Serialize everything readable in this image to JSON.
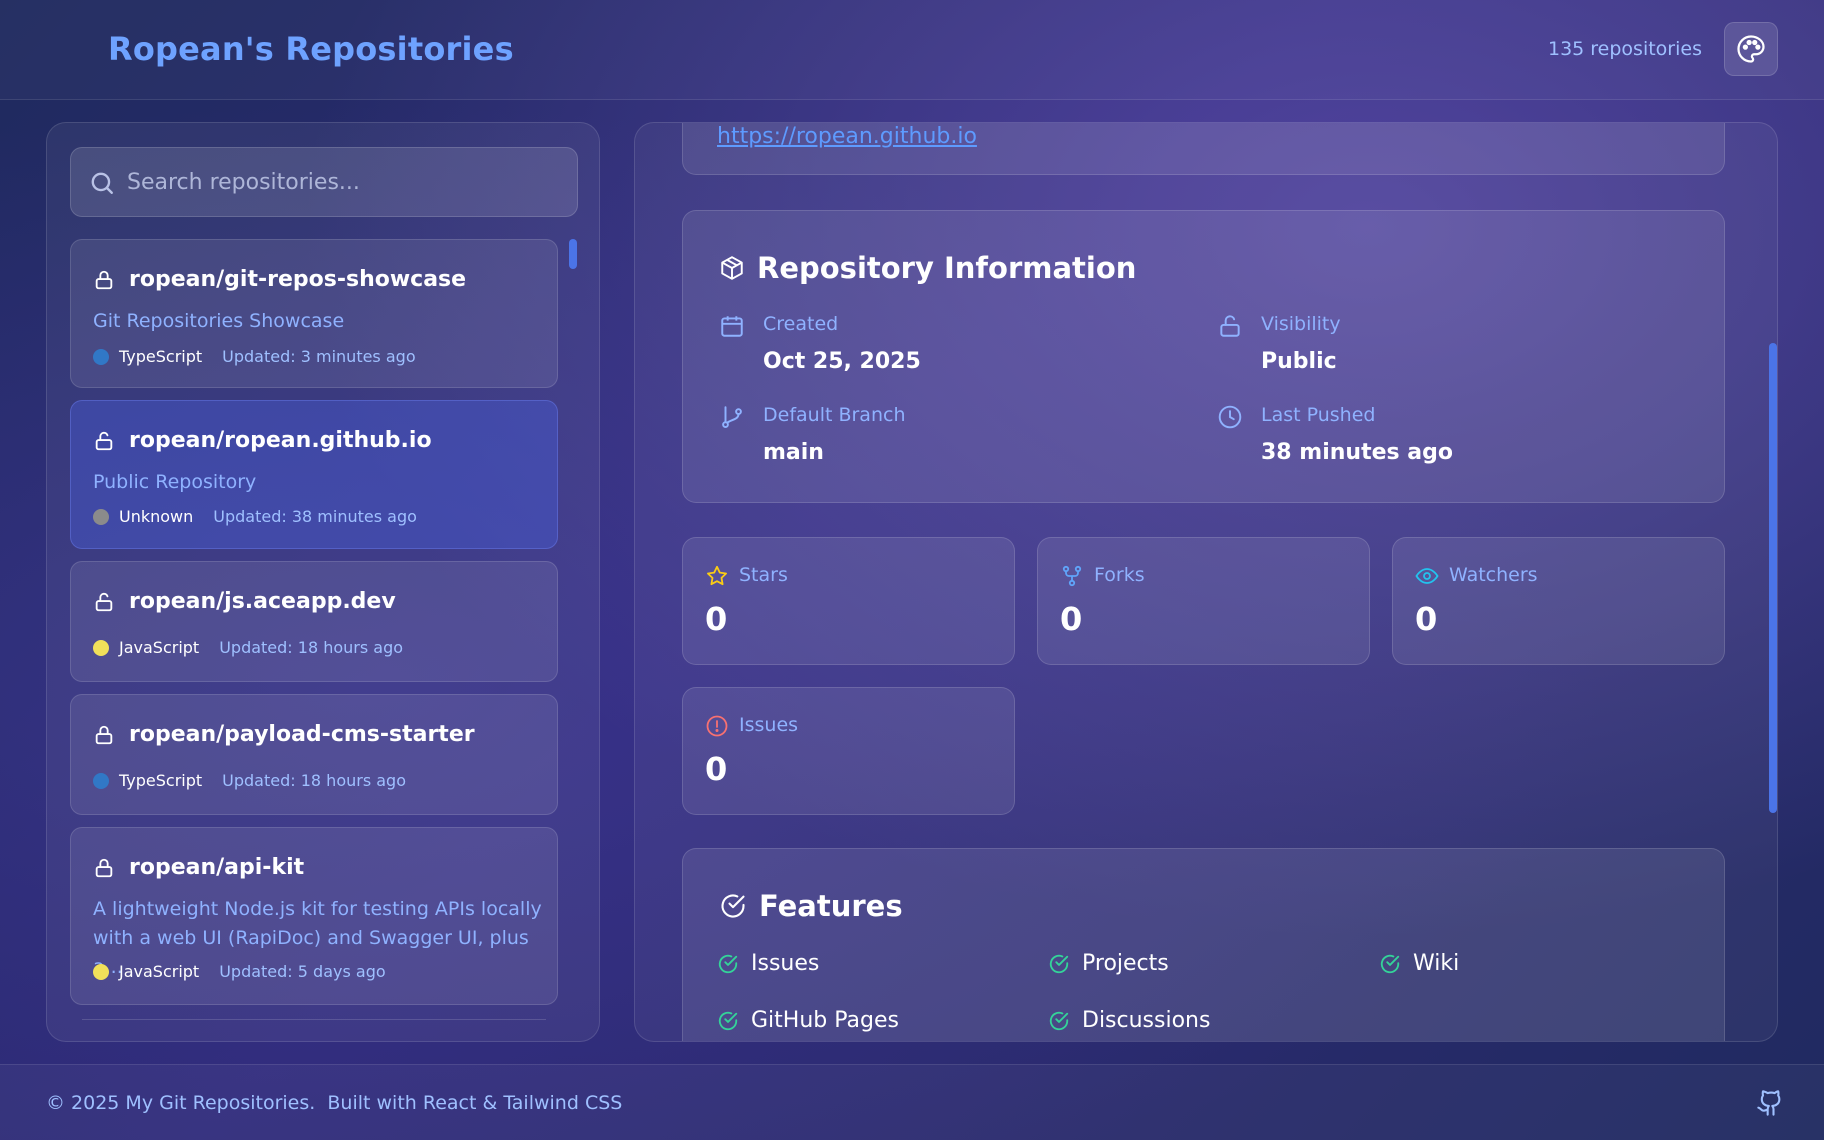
{
  "header": {
    "title": "Ropean's Repositories",
    "repo_count": "135 repositories",
    "theme_icon": "palette-icon"
  },
  "search": {
    "placeholder": "Search repositories...",
    "value": ""
  },
  "repos": [
    {
      "name": "ropean/git-repos-showcase",
      "description": "Git Repositories Showcase",
      "language": "TypeScript",
      "language_color": "#3178c6",
      "updated": "Updated: 3 minutes ago",
      "lock_icon": "lock-closed-icon",
      "selected": false
    },
    {
      "name": "ropean/ropean.github.io",
      "description": "Public Repository",
      "language": "Unknown",
      "language_color": "#8b8b8b",
      "updated": "Updated: 38 minutes ago",
      "lock_icon": "lock-open-icon",
      "selected": true
    },
    {
      "name": "ropean/js.aceapp.dev",
      "description": "",
      "language": "JavaScript",
      "language_color": "#f1e05a",
      "updated": "Updated: 18 hours ago",
      "lock_icon": "lock-open-icon",
      "selected": false
    },
    {
      "name": "ropean/payload-cms-starter",
      "description": "",
      "language": "TypeScript",
      "language_color": "#3178c6",
      "updated": "Updated: 18 hours ago",
      "lock_icon": "lock-closed-icon",
      "selected": false
    },
    {
      "name": "ropean/api-kit",
      "description": "A lightweight Node.js kit for testing APIs locally with a web UI (RapiDoc) and Swagger UI, plus a...",
      "language": "JavaScript",
      "language_color": "#f1e05a",
      "updated": "Updated: 5 days ago",
      "lock_icon": "lock-closed-icon",
      "selected": false
    }
  ],
  "detail": {
    "homepage": "https://ropean.github.io",
    "info": {
      "title": "Repository Information",
      "created_label": "Created",
      "created_value": "Oct 25, 2025",
      "visibility_label": "Visibility",
      "visibility_value": "Public",
      "branch_label": "Default Branch",
      "branch_value": "main",
      "pushed_label": "Last Pushed",
      "pushed_value": "38 minutes ago"
    },
    "stats": {
      "stars_label": "Stars",
      "stars_value": "0",
      "forks_label": "Forks",
      "forks_value": "0",
      "watchers_label": "Watchers",
      "watchers_value": "0",
      "issues_label": "Issues",
      "issues_value": "0"
    },
    "features": {
      "title": "Features",
      "items": [
        "Issues",
        "Projects",
        "Wiki",
        "GitHub Pages",
        "Discussions"
      ]
    }
  },
  "footer": {
    "text": "© 2025 My Git Repositories.  Built with React & Tailwind CSS",
    "icon": "github-icon"
  },
  "colors": {
    "accent": "#6ea2ff",
    "link": "#5e9bff",
    "success": "#34d399",
    "star": "#facc15",
    "issue": "#f87171"
  }
}
